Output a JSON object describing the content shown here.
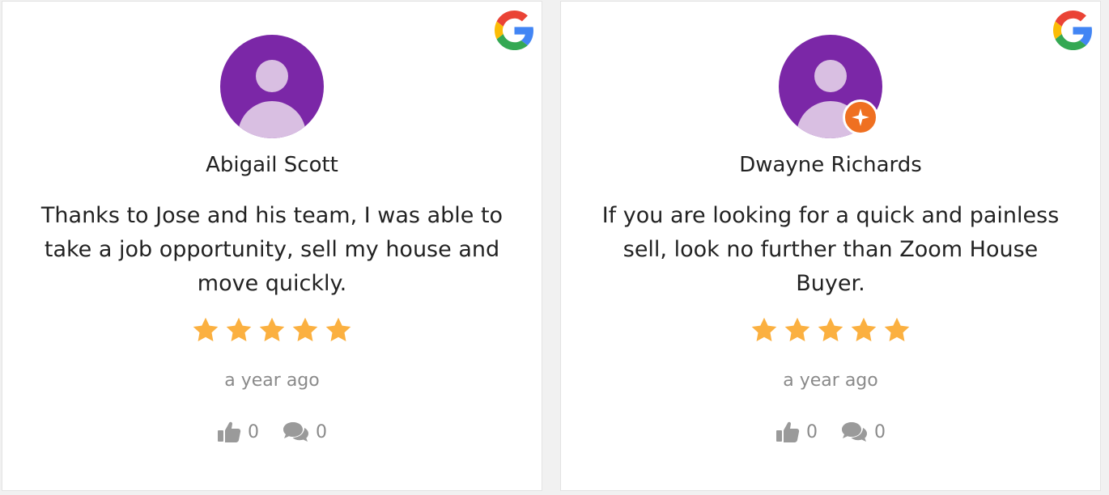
{
  "reviews": [
    {
      "name": "Abigail Scott",
      "text": "Thanks to Jose and his team, I was able to take a job opportunity, sell my house and move quickly.",
      "rating": 5,
      "time": "a year ago",
      "likes": "0",
      "comments": "0",
      "badge": false
    },
    {
      "name": "Dwayne Richards",
      "text": "If you are looking for a quick and painless sell, look no further than Zoom House Buyer.",
      "rating": 5,
      "time": "a year ago",
      "likes": "0",
      "comments": "0",
      "badge": true
    }
  ],
  "icons": {
    "source": "google-g-icon",
    "avatar": "user-avatar-icon",
    "badge": "local-guide-badge-icon",
    "star": "star-icon",
    "like": "thumbs-up-icon",
    "comment": "comments-icon"
  },
  "colors": {
    "avatar_bg": "#7b27a7",
    "avatar_fg": "#d9bfe2",
    "badge": "#ef7021",
    "star": "#fbb040",
    "muted": "#8a8a8a",
    "text": "#222222"
  }
}
